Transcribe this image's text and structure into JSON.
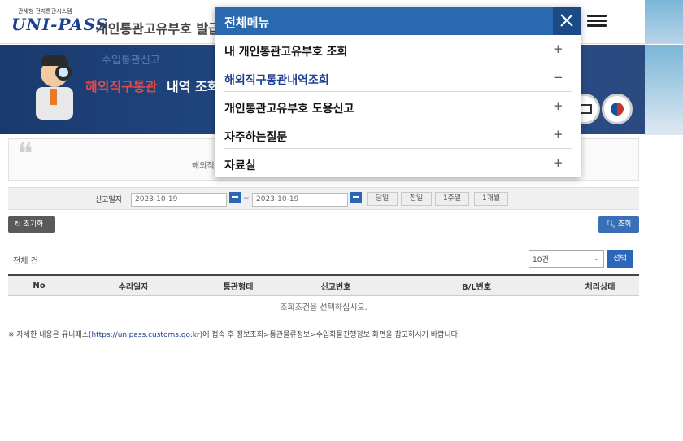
{
  "header": {
    "logo_sub": "관세청 전자통관시스템",
    "logo": "UNI-PASS",
    "site_title": "개인통관고유부호 발급",
    "menu_icon": "hamburger-icon"
  },
  "banner": {
    "crumb": "수입통관신고",
    "title_highlight": "해외직구통관",
    "title_rest": "내역 조회"
  },
  "quote": {
    "text": "해외직"
  },
  "search": {
    "label": "신고일자",
    "date_from": "2023-10-19",
    "date_to": "2023-10-19",
    "separator": "~",
    "quick_buttons": [
      "당일",
      "전일",
      "1주일",
      "1개월"
    ],
    "reset_label": "초기화",
    "query_label": "조회"
  },
  "results": {
    "total_label": "전체  건",
    "page_size": "10건",
    "select_label": "선택",
    "columns": [
      "No",
      "수리일자",
      "통관형태",
      "신고번호",
      "B/L번호",
      "처리상태"
    ],
    "empty_message": "조회조건을 선택하십시오."
  },
  "footnote": {
    "prefix": "※ 자세한 내용은 유니패스(",
    "link": "https://unipass.customs.go.kr",
    "suffix": ")에 접속 후 정보조회>통관물류정보>수입화물진행정보 화면을 참고하시기 바랍니다."
  },
  "modal": {
    "title": "전체메뉴",
    "close_icon": "close-icon",
    "items": [
      {
        "label": "내 개인통관고유부호 조회",
        "sign": "+"
      },
      {
        "label": "해외직구통관내역조회",
        "sign": "−"
      },
      {
        "label": "개인통관고유부호 도용신고",
        "sign": "+"
      },
      {
        "label": "자주하는질문",
        "sign": "+"
      },
      {
        "label": "자료실",
        "sign": "+"
      }
    ]
  },
  "colors": {
    "brand_blue": "#2a68b0",
    "active_text": "#1d3f8f",
    "highlight_red": "#e24a4a"
  }
}
